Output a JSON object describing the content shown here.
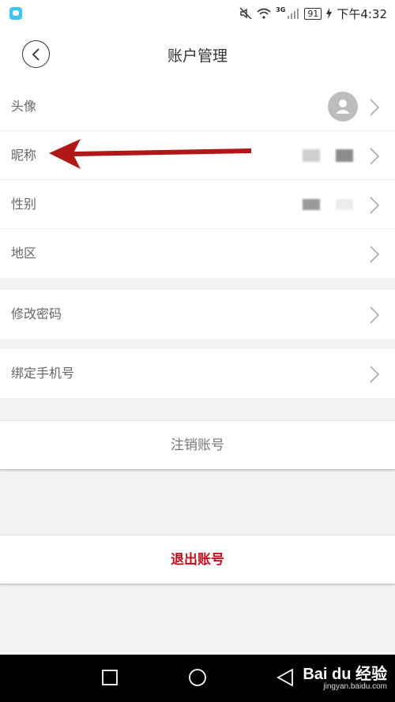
{
  "status_bar": {
    "time": "下午4:32",
    "battery": "91",
    "network": "3G"
  },
  "header": {
    "title": "账户管理"
  },
  "profile_group": [
    {
      "label": "头像"
    },
    {
      "label": "昵称"
    },
    {
      "label": "性别"
    },
    {
      "label": "地区"
    }
  ],
  "password_row": {
    "label": "修改密码"
  },
  "bind_phone_row": {
    "label": "绑定手机号"
  },
  "cancel_account": {
    "label": "注销账号"
  },
  "logout": {
    "label": "退出账号"
  },
  "watermark": {
    "main": "Bai du 经验",
    "sub": "jingyan.baidu.com"
  },
  "colors": {
    "logout_red": "#c0101f",
    "annotation_arrow": "#b01818",
    "app_icon": "#3ec5f0"
  },
  "icons": {
    "back": "chevron-left-icon",
    "row_arrow": "chevron-right-icon",
    "avatar": "user-silhouette-icon"
  }
}
